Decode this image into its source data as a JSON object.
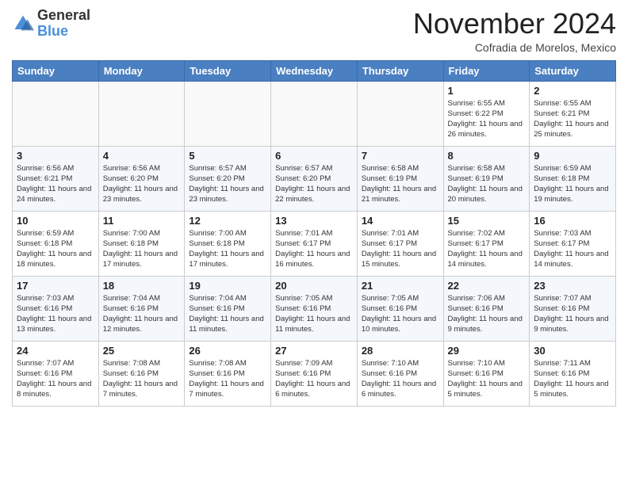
{
  "header": {
    "logo_general": "General",
    "logo_blue": "Blue",
    "month_title": "November 2024",
    "subtitle": "Cofradia de Morelos, Mexico"
  },
  "days_of_week": [
    "Sunday",
    "Monday",
    "Tuesday",
    "Wednesday",
    "Thursday",
    "Friday",
    "Saturday"
  ],
  "weeks": [
    [
      {
        "day": "",
        "info": ""
      },
      {
        "day": "",
        "info": ""
      },
      {
        "day": "",
        "info": ""
      },
      {
        "day": "",
        "info": ""
      },
      {
        "day": "",
        "info": ""
      },
      {
        "day": "1",
        "info": "Sunrise: 6:55 AM\nSunset: 6:22 PM\nDaylight: 11 hours and 26 minutes."
      },
      {
        "day": "2",
        "info": "Sunrise: 6:55 AM\nSunset: 6:21 PM\nDaylight: 11 hours and 25 minutes."
      }
    ],
    [
      {
        "day": "3",
        "info": "Sunrise: 6:56 AM\nSunset: 6:21 PM\nDaylight: 11 hours and 24 minutes."
      },
      {
        "day": "4",
        "info": "Sunrise: 6:56 AM\nSunset: 6:20 PM\nDaylight: 11 hours and 23 minutes."
      },
      {
        "day": "5",
        "info": "Sunrise: 6:57 AM\nSunset: 6:20 PM\nDaylight: 11 hours and 23 minutes."
      },
      {
        "day": "6",
        "info": "Sunrise: 6:57 AM\nSunset: 6:20 PM\nDaylight: 11 hours and 22 minutes."
      },
      {
        "day": "7",
        "info": "Sunrise: 6:58 AM\nSunset: 6:19 PM\nDaylight: 11 hours and 21 minutes."
      },
      {
        "day": "8",
        "info": "Sunrise: 6:58 AM\nSunset: 6:19 PM\nDaylight: 11 hours and 20 minutes."
      },
      {
        "day": "9",
        "info": "Sunrise: 6:59 AM\nSunset: 6:18 PM\nDaylight: 11 hours and 19 minutes."
      }
    ],
    [
      {
        "day": "10",
        "info": "Sunrise: 6:59 AM\nSunset: 6:18 PM\nDaylight: 11 hours and 18 minutes."
      },
      {
        "day": "11",
        "info": "Sunrise: 7:00 AM\nSunset: 6:18 PM\nDaylight: 11 hours and 17 minutes."
      },
      {
        "day": "12",
        "info": "Sunrise: 7:00 AM\nSunset: 6:18 PM\nDaylight: 11 hours and 17 minutes."
      },
      {
        "day": "13",
        "info": "Sunrise: 7:01 AM\nSunset: 6:17 PM\nDaylight: 11 hours and 16 minutes."
      },
      {
        "day": "14",
        "info": "Sunrise: 7:01 AM\nSunset: 6:17 PM\nDaylight: 11 hours and 15 minutes."
      },
      {
        "day": "15",
        "info": "Sunrise: 7:02 AM\nSunset: 6:17 PM\nDaylight: 11 hours and 14 minutes."
      },
      {
        "day": "16",
        "info": "Sunrise: 7:03 AM\nSunset: 6:17 PM\nDaylight: 11 hours and 14 minutes."
      }
    ],
    [
      {
        "day": "17",
        "info": "Sunrise: 7:03 AM\nSunset: 6:16 PM\nDaylight: 11 hours and 13 minutes."
      },
      {
        "day": "18",
        "info": "Sunrise: 7:04 AM\nSunset: 6:16 PM\nDaylight: 11 hours and 12 minutes."
      },
      {
        "day": "19",
        "info": "Sunrise: 7:04 AM\nSunset: 6:16 PM\nDaylight: 11 hours and 11 minutes."
      },
      {
        "day": "20",
        "info": "Sunrise: 7:05 AM\nSunset: 6:16 PM\nDaylight: 11 hours and 11 minutes."
      },
      {
        "day": "21",
        "info": "Sunrise: 7:05 AM\nSunset: 6:16 PM\nDaylight: 11 hours and 10 minutes."
      },
      {
        "day": "22",
        "info": "Sunrise: 7:06 AM\nSunset: 6:16 PM\nDaylight: 11 hours and 9 minutes."
      },
      {
        "day": "23",
        "info": "Sunrise: 7:07 AM\nSunset: 6:16 PM\nDaylight: 11 hours and 9 minutes."
      }
    ],
    [
      {
        "day": "24",
        "info": "Sunrise: 7:07 AM\nSunset: 6:16 PM\nDaylight: 11 hours and 8 minutes."
      },
      {
        "day": "25",
        "info": "Sunrise: 7:08 AM\nSunset: 6:16 PM\nDaylight: 11 hours and 7 minutes."
      },
      {
        "day": "26",
        "info": "Sunrise: 7:08 AM\nSunset: 6:16 PM\nDaylight: 11 hours and 7 minutes."
      },
      {
        "day": "27",
        "info": "Sunrise: 7:09 AM\nSunset: 6:16 PM\nDaylight: 11 hours and 6 minutes."
      },
      {
        "day": "28",
        "info": "Sunrise: 7:10 AM\nSunset: 6:16 PM\nDaylight: 11 hours and 6 minutes."
      },
      {
        "day": "29",
        "info": "Sunrise: 7:10 AM\nSunset: 6:16 PM\nDaylight: 11 hours and 5 minutes."
      },
      {
        "day": "30",
        "info": "Sunrise: 7:11 AM\nSunset: 6:16 PM\nDaylight: 11 hours and 5 minutes."
      }
    ]
  ]
}
